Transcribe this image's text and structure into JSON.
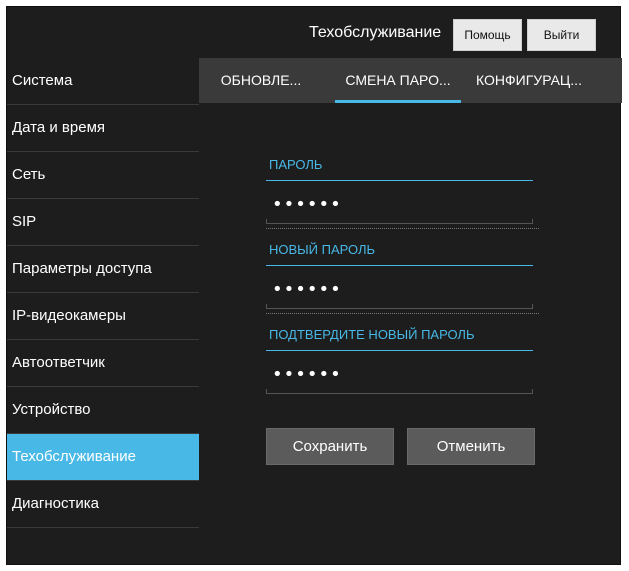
{
  "header": {
    "title": "Техобслуживание",
    "help_label": "Помощь",
    "logout_label": "Выйти"
  },
  "sidebar": {
    "items": [
      {
        "label": "Система"
      },
      {
        "label": "Дата и время"
      },
      {
        "label": "Сеть"
      },
      {
        "label": "SIP"
      },
      {
        "label": "Параметры доступа"
      },
      {
        "label": "IP-видеокамеры"
      },
      {
        "label": "Автоответчик"
      },
      {
        "label": "Устройство"
      },
      {
        "label": "Техобслуживание",
        "active": true
      },
      {
        "label": "Диагностика"
      }
    ]
  },
  "tabs": [
    {
      "label": "ОБНОВЛЕ..."
    },
    {
      "label": "СМЕНА ПАРО...",
      "active": true
    },
    {
      "label": "КОНФИГУРАЦ..."
    }
  ],
  "form": {
    "fields": [
      {
        "label": "ПАРОЛЬ",
        "value": "••••••"
      },
      {
        "label": "НОВЫЙ ПАРОЛЬ",
        "value": "••••••"
      },
      {
        "label": "ПОДТВЕРДИТЕ НОВЫЙ ПАРОЛЬ",
        "value": "••••••"
      }
    ],
    "save_label": "Сохранить",
    "cancel_label": "Отменить"
  },
  "colors": {
    "accent": "#48b8e6",
    "background": "#1d1d1d",
    "tabbar": "#3a3a3a",
    "button": "#5b5b5b"
  }
}
